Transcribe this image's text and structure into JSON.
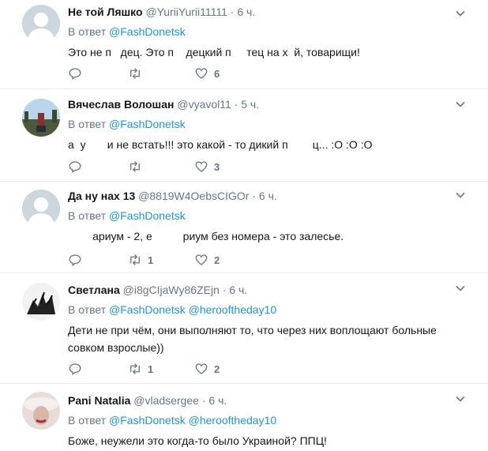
{
  "tweets": [
    {
      "name": "Не той Ляшко",
      "handle": "@YuriiYurii11111",
      "dot": "·",
      "time": "6 ч.",
      "reply_label": "В ответ",
      "reply_to": [
        "@FashDonetsk"
      ],
      "text": "Это не п   дец. Это п    децкий п     тец на х  й, товарищи!",
      "replies": "",
      "retweets": "",
      "likes": "6"
    },
    {
      "name": "Вячеслав Волошан",
      "handle": "@vyavol11",
      "dot": "·",
      "time": "5 ч.",
      "reply_label": "В ответ",
      "reply_to": [
        "@FashDonetsk"
      ],
      "text": "а  у       и не встать!!! это какой - то дикий п        ц... :О :О :О",
      "replies": "",
      "retweets": "",
      "likes": "3"
    },
    {
      "name": "Да ну нах 13",
      "handle": "@8819W4OebsCIGOr",
      "dot": "·",
      "time": "6 ч.",
      "reply_label": "В ответ",
      "reply_to": [
        "@FashDonetsk"
      ],
      "text": "        ариум - 2, е          риум без номера - это залесье.",
      "replies": "",
      "retweets": "1",
      "likes": "2"
    },
    {
      "name": "Светлана",
      "handle": "@i8gCIjaWy86ZEjn",
      "dot": "·",
      "time": "6 ч.",
      "reply_label": "В ответ",
      "reply_to": [
        "@FashDonetsk",
        "@herooftheday10"
      ],
      "text": "Дети не при чём, они выполняют то, что через них воплощают больные совком взрослые))",
      "replies": "",
      "retweets": "1",
      "likes": "2"
    },
    {
      "name": "Pani Natalia",
      "handle": "@vladsergee",
      "dot": "·",
      "time": "6 ч.",
      "reply_label": "В ответ",
      "reply_to": [
        "@FashDonetsk",
        "@herooftheday10"
      ],
      "text": "Боже, неужели это когда-то было Украиной? ППЦ!",
      "replies": "",
      "retweets": "",
      "likes": ""
    }
  ],
  "colors": {
    "accent": "#1b95e0",
    "muted": "#657786",
    "divider": "#e6ecf0"
  },
  "icons": [
    "reply-icon",
    "retweet-icon",
    "like-icon",
    "caret-down-icon"
  ]
}
